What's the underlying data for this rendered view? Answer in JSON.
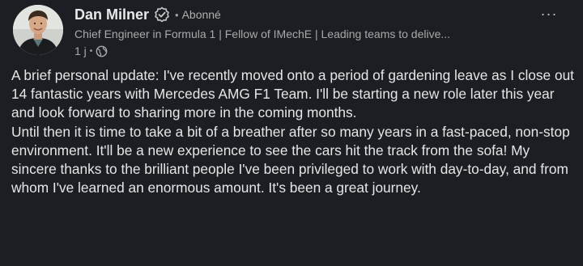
{
  "author": {
    "name": "Dan Milner",
    "follow_status": "Abonné",
    "headline": "Chief Engineer in Formula 1 | Fellow of IMechE | Leading teams to delive...",
    "time": "1 j",
    "separator": "•"
  },
  "post": {
    "paragraph_1": "A brief personal update: I've recently moved onto a period of gardening leave as I close out 14 fantastic years with Mercedes AMG F1 Team. I'll be starting a new role later this year and look forward to sharing more in the coming months.",
    "paragraph_2": "Until then it is time to take a bit of a breather after so many years in a fast-paced, non-stop environment. It'll be a new experience to see the cars hit the track from the sofa! My sincere thanks to the brilliant people I've been privileged to work with day-to-day, and from whom I've learned an enormous amount. It's been a great journey."
  },
  "controls": {
    "more_label": "···"
  },
  "colors": {
    "background": "#1b1f23",
    "text_primary": "#e9e9e9",
    "text_secondary": "#a9a9a9"
  },
  "icons": {
    "verified": "verified-badge-icon",
    "visibility": "globe-icon",
    "more": "more-icon"
  }
}
